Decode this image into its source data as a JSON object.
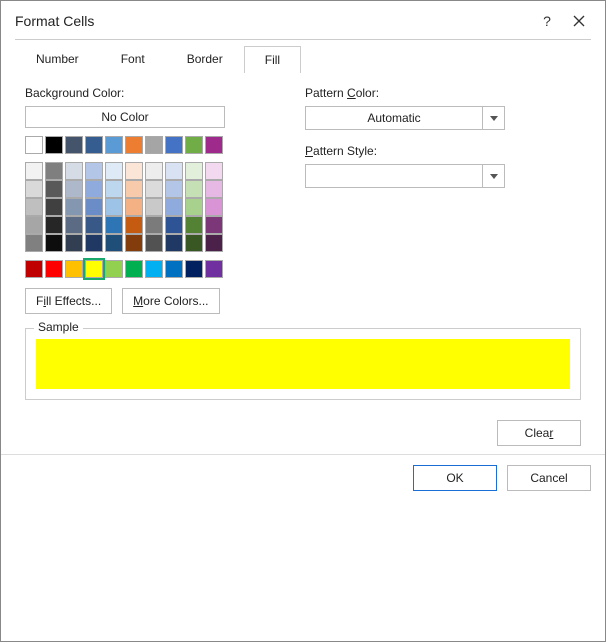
{
  "title": "Format Cells",
  "tabs": {
    "number": "Number",
    "font": "Font",
    "border": "Border",
    "fill": "Fill"
  },
  "activeTab": "fill",
  "fill": {
    "bgLabel": "Background Color:",
    "noColor": "No Color",
    "fillEffects": "Fill Effects...",
    "moreColors": "More Colors...",
    "patternColorLabel": "Pattern Color:",
    "patternColorValue": "Automatic",
    "patternStyleLabel": "Pattern Style:",
    "patternStyleValue": "",
    "sampleLabel": "Sample",
    "sampleColor": "#ffff00",
    "clear": "Clear",
    "selectedColor": "#ffff00",
    "palette": {
      "row1": [
        "#ffffff",
        "#000000",
        "#44546a",
        "#355d8f",
        "#5b9bd5",
        "#ed7d31",
        "#a5a5a5",
        "#4472c4",
        "#70ad47",
        "#9e2b8b"
      ],
      "themeRows": [
        [
          "#f2f2f2",
          "#7f7f7f",
          "#d6dce5",
          "#b4c6e7",
          "#deebf7",
          "#fbe5d6",
          "#ededed",
          "#d9e2f3",
          "#e2efda",
          "#f2d9f0"
        ],
        [
          "#d9d9d9",
          "#595959",
          "#adb9ca",
          "#8faadc",
          "#bdd7ee",
          "#f7caac",
          "#dbdbdb",
          "#b4c6e7",
          "#c5e0b4",
          "#e6b9e4"
        ],
        [
          "#bfbfbf",
          "#404040",
          "#8497b0",
          "#6a8cc7",
          "#9dc3e6",
          "#f4b183",
          "#c9c9c9",
          "#8faadc",
          "#a9d18e",
          "#d994d6"
        ],
        [
          "#a6a6a6",
          "#262626",
          "#5b6b84",
          "#385888",
          "#2e75b6",
          "#c55a11",
          "#7b7b7b",
          "#2f5496",
          "#548235",
          "#7b3778"
        ],
        [
          "#808080",
          "#0d0d0d",
          "#323f52",
          "#1f3864",
          "#1f4e79",
          "#833c0c",
          "#525252",
          "#1f3864",
          "#385723",
          "#4b2149"
        ]
      ],
      "standard": [
        "#c00000",
        "#ff0000",
        "#ffc000",
        "#ffff00",
        "#92d050",
        "#00b050",
        "#00b0f0",
        "#0070c0",
        "#002060",
        "#7030a0"
      ]
    }
  },
  "buttons": {
    "ok": "OK",
    "cancel": "Cancel"
  }
}
